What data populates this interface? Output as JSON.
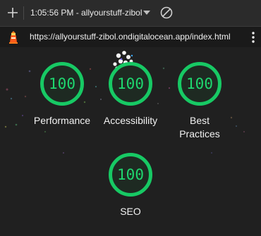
{
  "browser": {
    "tab_title": "1:05:56 PM - allyourstuff-zibol",
    "url": "https://allyourstuff-zibol.ondigitalocean.app/index.html",
    "icons": {
      "new_tab": "plus-icon",
      "tab_menu": "chevron-down-icon",
      "block": "block-icon",
      "site": "lighthouse-icon",
      "menu": "more-vertical-icon"
    }
  },
  "lighthouse": {
    "accent_color": "#17c964",
    "gauges": [
      {
        "label": "Performance",
        "score": "100"
      },
      {
        "label": "Accessibility",
        "score": "100"
      },
      {
        "label": "Best Practices",
        "score": "100"
      },
      {
        "label": "SEO",
        "score": "100"
      }
    ]
  }
}
